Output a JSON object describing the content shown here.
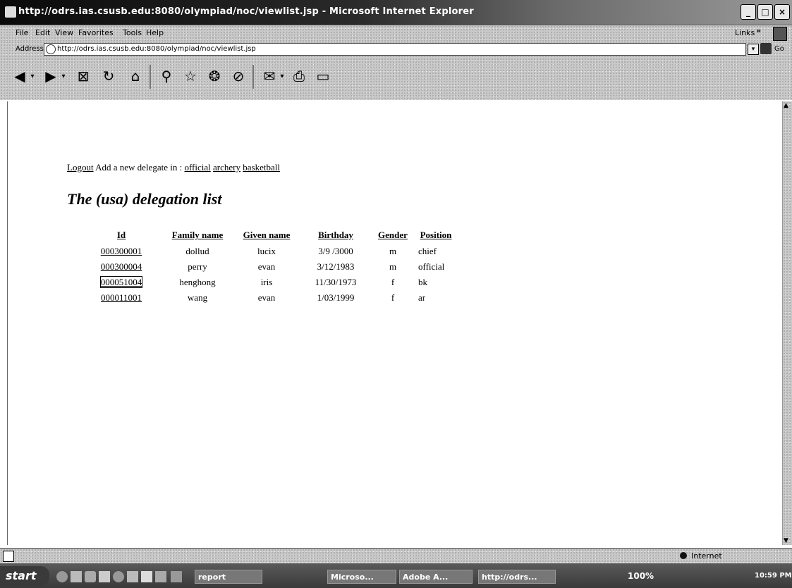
{
  "window": {
    "title": "http://odrs.ias.csusb.edu:8080/olympiad/noc/viewlist.jsp - Microsoft Internet Explorer"
  },
  "menu": [
    "File",
    "Edit",
    "View",
    "Favorites",
    "Tools",
    "Help"
  ],
  "links_label": "Links",
  "address": {
    "label": "Address",
    "url": "http://odrs.ias.csusb.edu:8080/olympiad/noc/viewlist.jsp",
    "go": "Go"
  },
  "page": {
    "logout": "Logout",
    "add_text": "Add a new delegate in :",
    "links": [
      "official",
      "archery",
      "basketball"
    ],
    "heading": "The (usa) delegation list",
    "table": {
      "headers": [
        "Id",
        "Family name",
        "Given name",
        "Birthday",
        "Gender",
        "Position"
      ],
      "rows": [
        [
          "000300001",
          "dollud",
          "lucix",
          "3/9 /3000",
          "m",
          "chief"
        ],
        [
          "000300004",
          "perry",
          "evan",
          "3/12/1983",
          "m",
          "official"
        ],
        [
          "000051004",
          "henghong",
          "iris",
          "11/30/1973",
          "f",
          "bk"
        ],
        [
          "000011001",
          "wang",
          "evan",
          "1/03/1999",
          "f",
          "ar"
        ]
      ]
    }
  },
  "status": {
    "zone": "Internet"
  },
  "taskbar": {
    "start": "start",
    "tasks": [
      "report",
      "Microso...",
      "Adobe A...",
      "http://odrs...",
      "100%"
    ],
    "clock": "10:59 PM"
  }
}
